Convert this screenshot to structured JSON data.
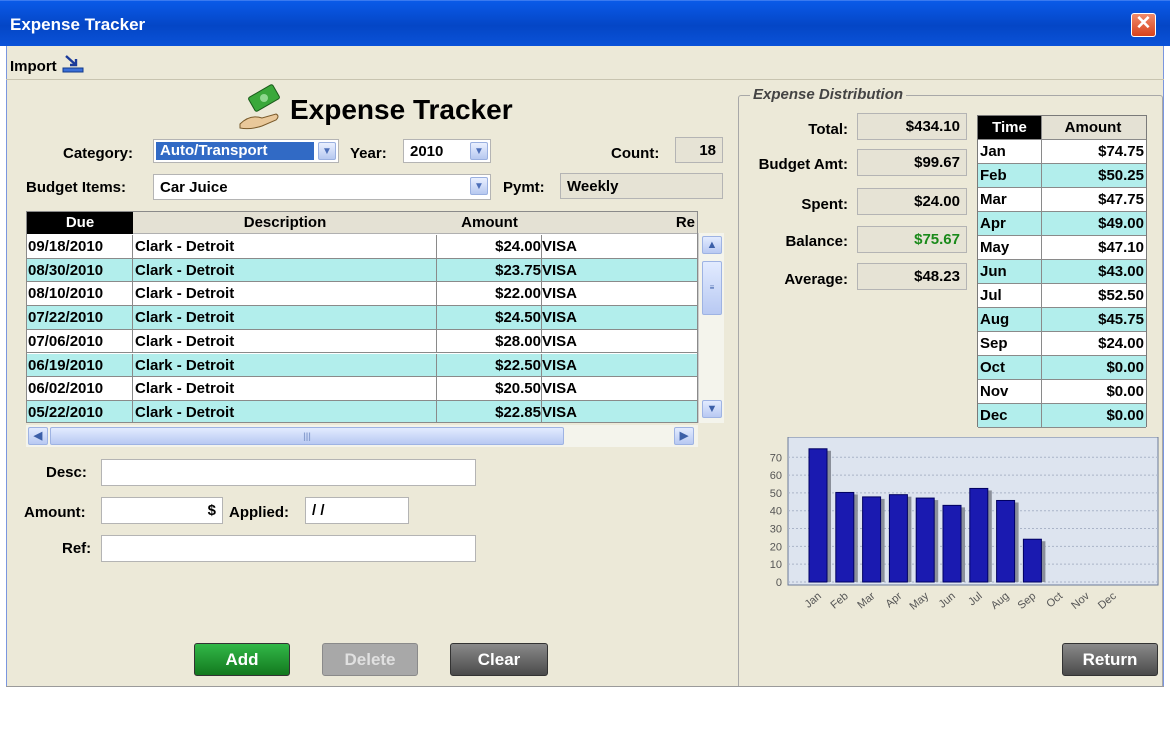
{
  "window": {
    "title": "Expense Tracker",
    "close_symbol": "✕"
  },
  "menu": {
    "import_label": "Import"
  },
  "header": {
    "title": "Expense Tracker"
  },
  "form": {
    "category_label": "Category:",
    "category_value": "Auto/Transport",
    "year_label": "Year:",
    "year_value": "2010",
    "count_label": "Count:",
    "count_value": "18",
    "budget_items_label": "Budget Items:",
    "budget_items_value": "Car Juice",
    "pymt_label": "Pymt:",
    "pymt_value": "Weekly",
    "desc_label": "Desc:",
    "desc_value": "",
    "amount_label": "Amount:",
    "amount_currency": "$",
    "applied_label": "Applied:",
    "applied_value": "/ /",
    "ref_label": "Ref:",
    "ref_value": ""
  },
  "table": {
    "columns": [
      "Due",
      "Description",
      "Amount",
      "Re"
    ],
    "rows": [
      {
        "due": "09/18/2010",
        "description": "Clark - Detroit",
        "amount": "$24.00",
        "ref": "VISA"
      },
      {
        "due": "08/30/2010",
        "description": "Clark - Detroit",
        "amount": "$23.75",
        "ref": "VISA"
      },
      {
        "due": "08/10/2010",
        "description": "Clark - Detroit",
        "amount": "$22.00",
        "ref": "VISA"
      },
      {
        "due": "07/22/2010",
        "description": "Clark - Detroit",
        "amount": "$24.50",
        "ref": "VISA"
      },
      {
        "due": "07/06/2010",
        "description": "Clark - Detroit",
        "amount": "$28.00",
        "ref": "VISA"
      },
      {
        "due": "06/19/2010",
        "description": "Clark - Detroit",
        "amount": "$22.50",
        "ref": "VISA"
      },
      {
        "due": "06/02/2010",
        "description": "Clark - Detroit",
        "amount": "$20.50",
        "ref": "VISA"
      },
      {
        "due": "05/22/2010",
        "description": "Clark - Detroit",
        "amount": "$22.85",
        "ref": "VISA"
      }
    ],
    "hscroll_grip": "|||"
  },
  "buttons": {
    "add": "Add",
    "delete": "Delete",
    "clear": "Clear",
    "return": "Return"
  },
  "distribution": {
    "legend": "Expense Distribution",
    "total_label": "Total:",
    "total_value": "$434.10",
    "budget_label": "Budget Amt:",
    "budget_value": "$99.67",
    "spent_label": "Spent:",
    "spent_value": "$24.00",
    "balance_label": "Balance:",
    "balance_value": "$75.67",
    "average_label": "Average:",
    "average_value": "$48.23",
    "balance_color": "#1a8a1a",
    "time_header": "Time",
    "amount_header": "Amount",
    "months": [
      {
        "m": "Jan",
        "v": "$74.75"
      },
      {
        "m": "Feb",
        "v": "$50.25"
      },
      {
        "m": "Mar",
        "v": "$47.75"
      },
      {
        "m": "Apr",
        "v": "$49.00"
      },
      {
        "m": "May",
        "v": "$47.10"
      },
      {
        "m": "Jun",
        "v": "$43.00"
      },
      {
        "m": "Jul",
        "v": "$52.50"
      },
      {
        "m": "Aug",
        "v": "$45.75"
      },
      {
        "m": "Sep",
        "v": "$24.00"
      },
      {
        "m": "Oct",
        "v": "$0.00"
      },
      {
        "m": "Nov",
        "v": "$0.00"
      },
      {
        "m": "Dec",
        "v": "$0.00"
      }
    ]
  },
  "chart_data": {
    "type": "bar",
    "categories": [
      "Jan",
      "Feb",
      "Mar",
      "Apr",
      "May",
      "Jun",
      "Jul",
      "Aug",
      "Sep",
      "Oct",
      "Nov",
      "Dec"
    ],
    "values": [
      74.75,
      50.25,
      47.75,
      49.0,
      47.1,
      43.0,
      52.5,
      45.75,
      24.0,
      0,
      0,
      0
    ],
    "yticks": [
      "0",
      "10",
      "20",
      "30",
      "40",
      "50",
      "60",
      "70"
    ],
    "ylim": [
      0,
      78
    ],
    "bar_color": "#1a1ab0",
    "grid": true
  }
}
